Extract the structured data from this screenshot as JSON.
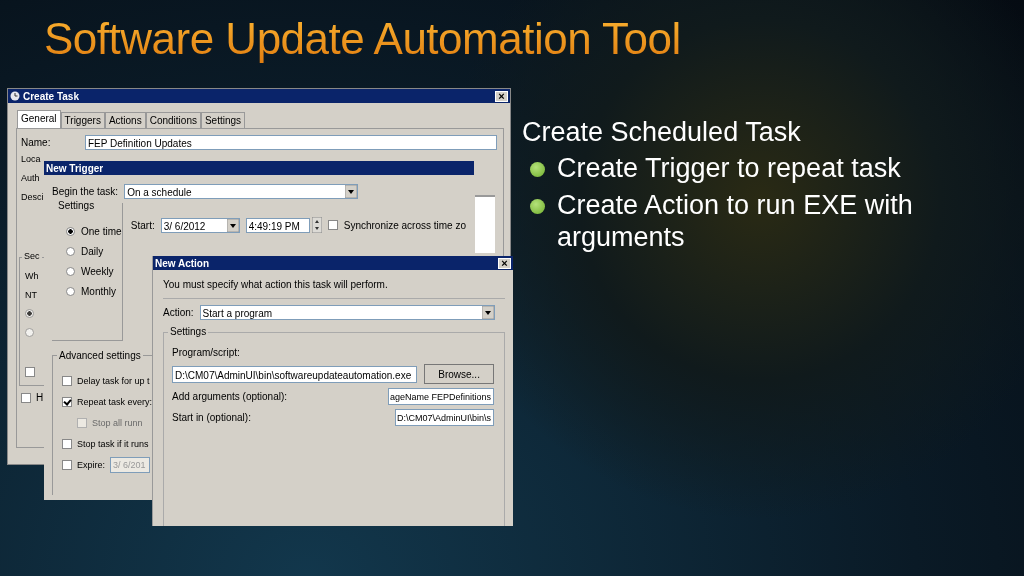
{
  "slide_title": "Software Update Automation Tool",
  "bullets": {
    "heading": "Create Scheduled Task",
    "items": [
      "Create Trigger to repeat task",
      "Create Action to run EXE with arguments"
    ]
  },
  "create_task": {
    "title": "Create Task",
    "close": "×",
    "tabs": [
      {
        "label": "General",
        "selected": true
      },
      {
        "label": "Triggers",
        "selected": false
      },
      {
        "label": "Actions",
        "selected": false
      },
      {
        "label": "Conditions",
        "selected": false
      },
      {
        "label": "Settings",
        "selected": false
      }
    ],
    "name_label": "Name:",
    "name_value": "FEP Definition Updates",
    "label_fragments": [
      "Loca",
      "Auth",
      "Desci"
    ],
    "security_group": {
      "legend": "Sec",
      "lines": [
        "Wh",
        "NT"
      ],
      "radios": [
        {
          "selected": true
        },
        {
          "selected": false
        }
      ],
      "checkbox": {
        "checked": false
      }
    },
    "hidden_checkbox": {
      "label": "H",
      "checked": false
    }
  },
  "new_trigger": {
    "title": "New Trigger",
    "begin_label": "Begin the task:",
    "begin_value": "On a schedule",
    "settings_legend": "Settings",
    "schedules": [
      {
        "label": "One time",
        "selected": true
      },
      {
        "label": "Daily",
        "selected": false
      },
      {
        "label": "Weekly",
        "selected": false
      },
      {
        "label": "Monthly",
        "selected": false
      }
    ],
    "start_label": "Start:",
    "start_date": "3/ 6/2012",
    "start_time": "4:49:19 PM",
    "sync": {
      "label": "Synchronize across time zo",
      "checked": false
    },
    "advanced_legend": "Advanced settings",
    "advanced": [
      {
        "label": "Delay task for up t",
        "checked": false,
        "disabled": false
      },
      {
        "label": "Repeat task every:",
        "checked": true,
        "disabled": false,
        "children": [
          {
            "label": "Stop all runn",
            "checked": false,
            "disabled": true
          }
        ]
      },
      {
        "label": "Stop task if it runs",
        "checked": false,
        "disabled": false
      },
      {
        "label": "Expire:",
        "checked": false,
        "disabled": false,
        "date": "3/ 6/201"
      }
    ]
  },
  "new_action": {
    "title": "New Action",
    "close": "×",
    "instruction": "You must specify what action this task will perform.",
    "action_label": "Action:",
    "action_value": "Start a program",
    "settings_legend": "Settings",
    "program_label": "Program/script:",
    "program_value": "D:\\CM07\\AdminUI\\bin\\softwareupdateautomation.exe",
    "browse": "Browse...",
    "args_label": "Add arguments (optional):",
    "args_value": "ageName FEPDefinitions",
    "start_in_label": "Start in (optional):",
    "start_in_value": "D:\\CM07\\AdminUI\\bin\\s"
  }
}
